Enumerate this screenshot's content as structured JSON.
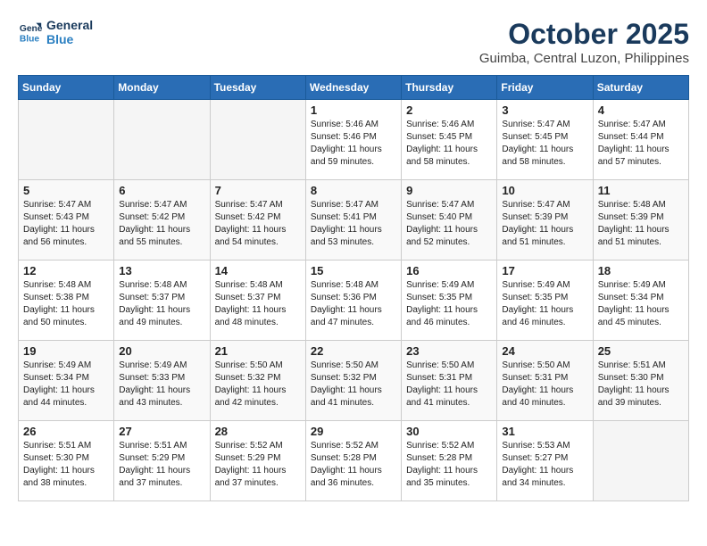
{
  "header": {
    "logo_line1": "General",
    "logo_line2": "Blue",
    "month": "October 2025",
    "location": "Guimba, Central Luzon, Philippines"
  },
  "weekdays": [
    "Sunday",
    "Monday",
    "Tuesday",
    "Wednesday",
    "Thursday",
    "Friday",
    "Saturday"
  ],
  "weeks": [
    [
      {
        "day": "",
        "info": ""
      },
      {
        "day": "",
        "info": ""
      },
      {
        "day": "",
        "info": ""
      },
      {
        "day": "1",
        "info": "Sunrise: 5:46 AM\nSunset: 5:46 PM\nDaylight: 11 hours\nand 59 minutes."
      },
      {
        "day": "2",
        "info": "Sunrise: 5:46 AM\nSunset: 5:45 PM\nDaylight: 11 hours\nand 58 minutes."
      },
      {
        "day": "3",
        "info": "Sunrise: 5:47 AM\nSunset: 5:45 PM\nDaylight: 11 hours\nand 58 minutes."
      },
      {
        "day": "4",
        "info": "Sunrise: 5:47 AM\nSunset: 5:44 PM\nDaylight: 11 hours\nand 57 minutes."
      }
    ],
    [
      {
        "day": "5",
        "info": "Sunrise: 5:47 AM\nSunset: 5:43 PM\nDaylight: 11 hours\nand 56 minutes."
      },
      {
        "day": "6",
        "info": "Sunrise: 5:47 AM\nSunset: 5:42 PM\nDaylight: 11 hours\nand 55 minutes."
      },
      {
        "day": "7",
        "info": "Sunrise: 5:47 AM\nSunset: 5:42 PM\nDaylight: 11 hours\nand 54 minutes."
      },
      {
        "day": "8",
        "info": "Sunrise: 5:47 AM\nSunset: 5:41 PM\nDaylight: 11 hours\nand 53 minutes."
      },
      {
        "day": "9",
        "info": "Sunrise: 5:47 AM\nSunset: 5:40 PM\nDaylight: 11 hours\nand 52 minutes."
      },
      {
        "day": "10",
        "info": "Sunrise: 5:47 AM\nSunset: 5:39 PM\nDaylight: 11 hours\nand 51 minutes."
      },
      {
        "day": "11",
        "info": "Sunrise: 5:48 AM\nSunset: 5:39 PM\nDaylight: 11 hours\nand 51 minutes."
      }
    ],
    [
      {
        "day": "12",
        "info": "Sunrise: 5:48 AM\nSunset: 5:38 PM\nDaylight: 11 hours\nand 50 minutes."
      },
      {
        "day": "13",
        "info": "Sunrise: 5:48 AM\nSunset: 5:37 PM\nDaylight: 11 hours\nand 49 minutes."
      },
      {
        "day": "14",
        "info": "Sunrise: 5:48 AM\nSunset: 5:37 PM\nDaylight: 11 hours\nand 48 minutes."
      },
      {
        "day": "15",
        "info": "Sunrise: 5:48 AM\nSunset: 5:36 PM\nDaylight: 11 hours\nand 47 minutes."
      },
      {
        "day": "16",
        "info": "Sunrise: 5:49 AM\nSunset: 5:35 PM\nDaylight: 11 hours\nand 46 minutes."
      },
      {
        "day": "17",
        "info": "Sunrise: 5:49 AM\nSunset: 5:35 PM\nDaylight: 11 hours\nand 46 minutes."
      },
      {
        "day": "18",
        "info": "Sunrise: 5:49 AM\nSunset: 5:34 PM\nDaylight: 11 hours\nand 45 minutes."
      }
    ],
    [
      {
        "day": "19",
        "info": "Sunrise: 5:49 AM\nSunset: 5:34 PM\nDaylight: 11 hours\nand 44 minutes."
      },
      {
        "day": "20",
        "info": "Sunrise: 5:49 AM\nSunset: 5:33 PM\nDaylight: 11 hours\nand 43 minutes."
      },
      {
        "day": "21",
        "info": "Sunrise: 5:50 AM\nSunset: 5:32 PM\nDaylight: 11 hours\nand 42 minutes."
      },
      {
        "day": "22",
        "info": "Sunrise: 5:50 AM\nSunset: 5:32 PM\nDaylight: 11 hours\nand 41 minutes."
      },
      {
        "day": "23",
        "info": "Sunrise: 5:50 AM\nSunset: 5:31 PM\nDaylight: 11 hours\nand 41 minutes."
      },
      {
        "day": "24",
        "info": "Sunrise: 5:50 AM\nSunset: 5:31 PM\nDaylight: 11 hours\nand 40 minutes."
      },
      {
        "day": "25",
        "info": "Sunrise: 5:51 AM\nSunset: 5:30 PM\nDaylight: 11 hours\nand 39 minutes."
      }
    ],
    [
      {
        "day": "26",
        "info": "Sunrise: 5:51 AM\nSunset: 5:30 PM\nDaylight: 11 hours\nand 38 minutes."
      },
      {
        "day": "27",
        "info": "Sunrise: 5:51 AM\nSunset: 5:29 PM\nDaylight: 11 hours\nand 37 minutes."
      },
      {
        "day": "28",
        "info": "Sunrise: 5:52 AM\nSunset: 5:29 PM\nDaylight: 11 hours\nand 37 minutes."
      },
      {
        "day": "29",
        "info": "Sunrise: 5:52 AM\nSunset: 5:28 PM\nDaylight: 11 hours\nand 36 minutes."
      },
      {
        "day": "30",
        "info": "Sunrise: 5:52 AM\nSunset: 5:28 PM\nDaylight: 11 hours\nand 35 minutes."
      },
      {
        "day": "31",
        "info": "Sunrise: 5:53 AM\nSunset: 5:27 PM\nDaylight: 11 hours\nand 34 minutes."
      },
      {
        "day": "",
        "info": ""
      }
    ]
  ]
}
